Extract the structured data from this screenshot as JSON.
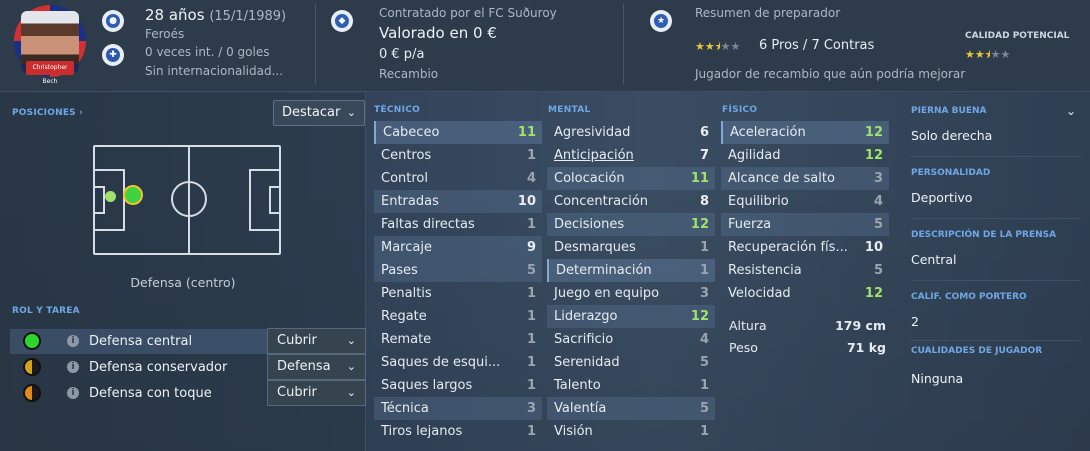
{
  "header": {
    "age": "28 años",
    "birth": "(15/1/1989)",
    "nation": "Feroés",
    "intl": "0 veces int. / 0 goles",
    "intl_status": "Sin internacionalidad...",
    "contract": "Contratado por el FC Suðuroy",
    "value": "Valorado en 0 €",
    "wage": "0 € p/a",
    "squad_status": "Recambio",
    "coach_title": "Resumen de preparador",
    "pros_cons": "6 Pros / 7 Contras",
    "coach_summary": "Jugador de recambio que aún podría mejorar",
    "potential_label": "CALIDAD POTENCIAL",
    "avatar_name": "Christopher Bech",
    "coach_stars": 2.5,
    "potential_stars": 2.5
  },
  "left": {
    "positions_label": "POSICIONES ›",
    "highlight": "Destacar",
    "position_name": "Defensa (centro)",
    "role_label": "ROL Y TAREA",
    "roles": [
      {
        "name": "Defensa central",
        "duty": "Cubrir"
      },
      {
        "name": "Defensa conservador",
        "duty": "Defensa"
      },
      {
        "name": "Defensa con toque",
        "duty": "Cubrir"
      }
    ]
  },
  "attributes": {
    "technical_label": "TÉCNICO",
    "mental_label": "MENTAL",
    "physical_label": "FÍSICO",
    "technical": [
      {
        "name": "Cabeceo",
        "value": "11"
      },
      {
        "name": "Centros",
        "value": "1"
      },
      {
        "name": "Control",
        "value": "4"
      },
      {
        "name": "Entradas",
        "value": "10"
      },
      {
        "name": "Faltas directas",
        "value": "1"
      },
      {
        "name": "Marcaje",
        "value": "9"
      },
      {
        "name": "Pases",
        "value": "5"
      },
      {
        "name": "Penaltis",
        "value": "1"
      },
      {
        "name": "Regate",
        "value": "1"
      },
      {
        "name": "Remate",
        "value": "1"
      },
      {
        "name": "Saques de esqui...",
        "value": "1"
      },
      {
        "name": "Saques largos",
        "value": "1"
      },
      {
        "name": "Técnica",
        "value": "3"
      },
      {
        "name": "Tiros lejanos",
        "value": "1"
      }
    ],
    "mental": [
      {
        "name": "Agresividad",
        "value": "6"
      },
      {
        "name": "Anticipación",
        "value": "7"
      },
      {
        "name": "Colocación",
        "value": "11"
      },
      {
        "name": "Concentración",
        "value": "8"
      },
      {
        "name": "Decisiones",
        "value": "12"
      },
      {
        "name": "Desmarques",
        "value": "1"
      },
      {
        "name": "Determinación",
        "value": "1"
      },
      {
        "name": "Juego en equipo",
        "value": "3"
      },
      {
        "name": "Liderazgo",
        "value": "12"
      },
      {
        "name": "Sacrificio",
        "value": "4"
      },
      {
        "name": "Serenidad",
        "value": "5"
      },
      {
        "name": "Talento",
        "value": "1"
      },
      {
        "name": "Valentía",
        "value": "5"
      },
      {
        "name": "Visión",
        "value": "1"
      }
    ],
    "physical": [
      {
        "name": "Aceleración",
        "value": "12"
      },
      {
        "name": "Agilidad",
        "value": "12"
      },
      {
        "name": "Alcance de salto",
        "value": "3"
      },
      {
        "name": "Equilibrio",
        "value": "4"
      },
      {
        "name": "Fuerza",
        "value": "5"
      },
      {
        "name": "Recuperación fís...",
        "value": "10"
      },
      {
        "name": "Resistencia",
        "value": "5"
      },
      {
        "name": "Velocidad",
        "value": "12"
      }
    ],
    "height_label": "Altura",
    "height": "179 cm",
    "weight_label": "Peso",
    "weight": "71 kg"
  },
  "right": {
    "foot_label": "PIERNA BUENA",
    "foot": "Solo derecha",
    "personality_label": "PERSONALIDAD",
    "personality": "Deportivo",
    "press_label": "DESCRIPCIÓN DE LA PRENSA",
    "press": "Central",
    "gk_label": "CALIF. COMO PORTERO",
    "gk": "2",
    "qualities_label": "CUALIDADES DE JUGADOR",
    "qualities": "Ninguna"
  },
  "colors": {
    "accent_blue": "#6fa7e6",
    "good_green": "#9fe36b",
    "star_gold": "#e9c43a"
  }
}
